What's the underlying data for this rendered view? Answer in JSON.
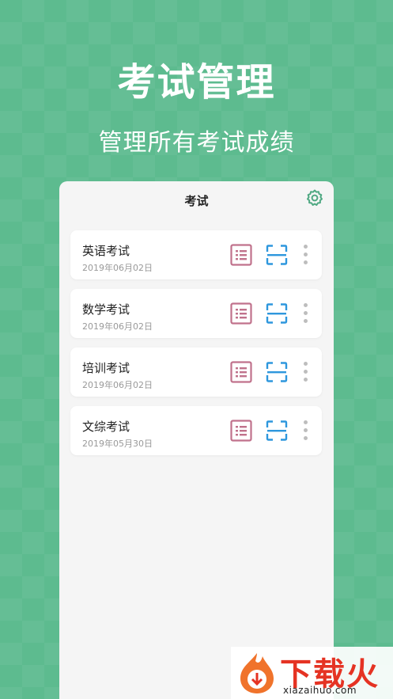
{
  "hero": {
    "title": "考试管理",
    "subtitle": "管理所有考试成绩"
  },
  "app": {
    "title": "考试",
    "settings_icon": "gear-icon"
  },
  "exams": [
    {
      "name": "英语考试",
      "date": "2019年06月02日"
    },
    {
      "name": "数学考试",
      "date": "2019年06月02日"
    },
    {
      "name": "培训考试",
      "date": "2019年06月02日"
    },
    {
      "name": "文综考试",
      "date": "2019年05月30日"
    }
  ],
  "icons": {
    "report": "report-grid-icon",
    "scan": "scan-icon",
    "more": "more-vertical-icon"
  },
  "colors": {
    "background": "#5dbb8f",
    "accent_green": "#4fa882",
    "report_icon": "#c0728c",
    "scan_icon": "#2e97dd"
  },
  "watermark": {
    "text": "下载火",
    "url": "xiazaihuo.com"
  }
}
